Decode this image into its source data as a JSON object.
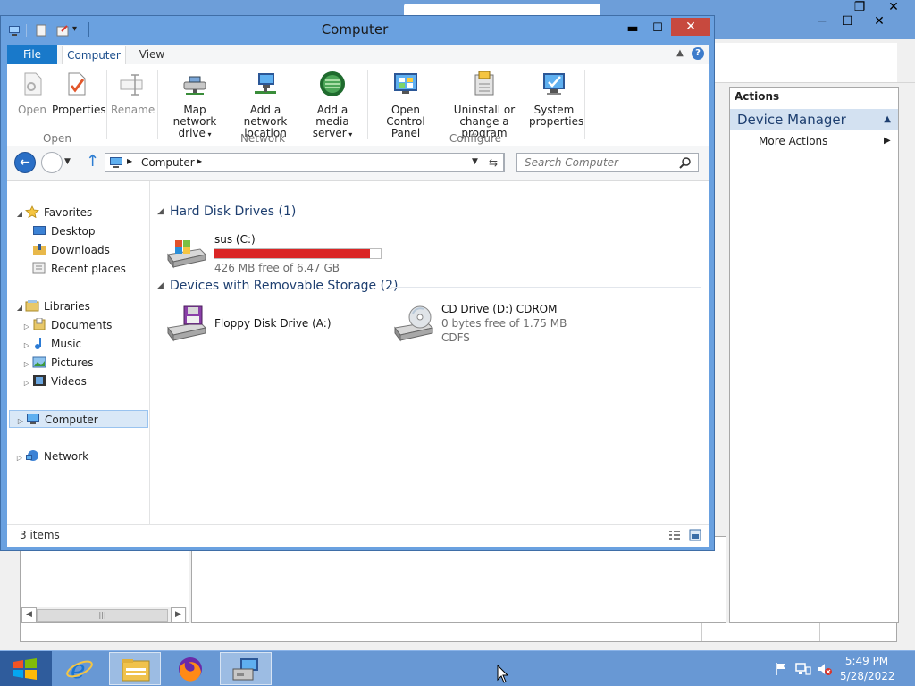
{
  "explorer": {
    "title": "Computer",
    "tabs": {
      "file": "File",
      "computer": "Computer",
      "view": "View"
    },
    "ribbon": {
      "open": "Open",
      "properties": "Properties",
      "rename": "Rename",
      "map_drive_1": "Map network",
      "map_drive_2": "drive",
      "add_location_1": "Add a network",
      "add_location_2": "location",
      "add_media_1": "Add a media",
      "add_media_2": "server",
      "control_panel_1": "Open Control",
      "control_panel_2": "Panel",
      "uninstall_1": "Uninstall or",
      "uninstall_2": "change a program",
      "system_props_1": "System",
      "system_props_2": "properties",
      "group_open": "Open",
      "group_network": "Network",
      "group_configure": "Configure"
    },
    "address": {
      "path": "Computer",
      "search_placeholder": "Search Computer"
    },
    "nav": {
      "favorites": "Favorites",
      "desktop": "Desktop",
      "downloads": "Downloads",
      "recent": "Recent places",
      "libraries": "Libraries",
      "documents": "Documents",
      "music": "Music",
      "pictures": "Pictures",
      "videos": "Videos",
      "computer": "Computer",
      "network": "Network"
    },
    "content": {
      "hdd_group": "Hard Disk Drives (1)",
      "removable_group": "Devices with Removable Storage (2)",
      "c_drive": {
        "name": "sus (C:)",
        "free": "426 MB free of 6.47 GB",
        "used_fraction": 0.936
      },
      "floppy": {
        "name": "Floppy Disk Drive (A:)"
      },
      "cd": {
        "name": "CD Drive (D:) CDROM",
        "free": "0 bytes free of 1.75 MB",
        "fs": "CDFS"
      }
    },
    "status": "3 items"
  },
  "mmc": {
    "actions_header": "Actions",
    "device_manager": "Device Manager",
    "more_actions": "More Actions"
  },
  "taskbar": {
    "time": "5:49 PM",
    "date": "5/28/2022"
  },
  "colors": {
    "accent": "#1979ca",
    "titlebar": "#6aa1e0",
    "close": "#c7493e",
    "drive_bar": "#da2626"
  }
}
